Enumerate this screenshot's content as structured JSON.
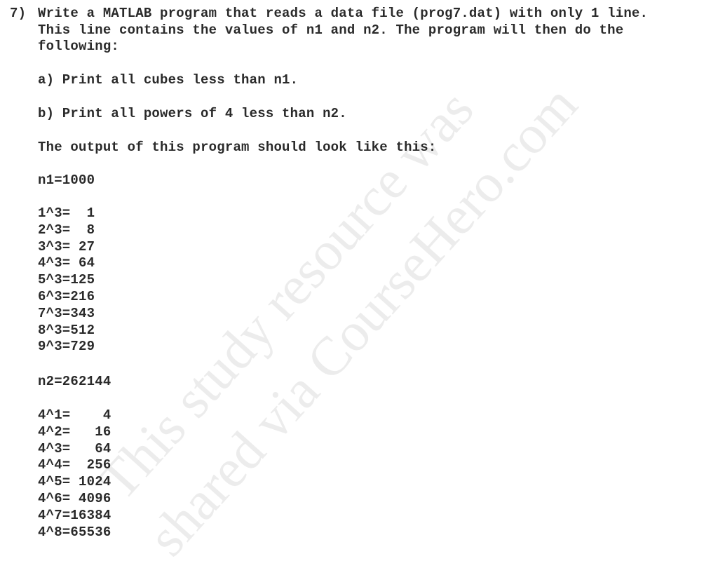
{
  "problem": {
    "number": "7)",
    "intro_lines": [
      "Write a MATLAB program that reads a data file (prog7.dat) with only 1 line.",
      "This line contains the values of n1 and n2. The program will then do the",
      "following:"
    ],
    "part_a": "a) Print all cubes less than n1.",
    "part_b": "b) Print all powers of 4 less than n2.",
    "output_intro": "The output of this program should look like this:",
    "n1_line": "n1=1000",
    "cubes": [
      "1^3=  1",
      "2^3=  8",
      "3^3= 27",
      "4^3= 64",
      "5^3=125",
      "6^3=216",
      "7^3=343",
      "8^3=512",
      "9^3=729"
    ],
    "n2_line": "n2=262144",
    "powers": [
      "4^1=    4",
      "4^2=   16",
      "4^3=   64",
      "4^4=  256",
      "4^5= 1024",
      "4^6= 4096",
      "4^7=16384",
      "4^8=65536"
    ]
  },
  "watermark": {
    "line1": "This study resource was",
    "line2": "shared via CourseHero.com"
  }
}
